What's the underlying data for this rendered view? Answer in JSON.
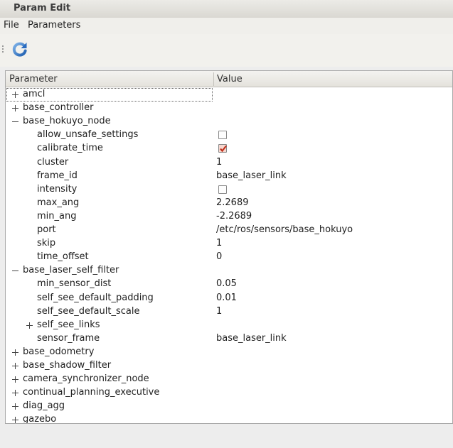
{
  "window": {
    "title": "Param Edit"
  },
  "menu": {
    "file": "File",
    "parameters": "Parameters"
  },
  "toolbar": {
    "refresh_icon": "refresh-icon"
  },
  "table": {
    "col_parameter": "Parameter",
    "col_value": "Value",
    "rows": [
      {
        "name": "amcl",
        "expander": "collapsed",
        "value": ""
      },
      {
        "name": "base_controller",
        "expander": "collapsed",
        "value": ""
      },
      {
        "name": "base_hokuyo_node",
        "expander": "expanded",
        "value": ""
      },
      {
        "name": "allow_unsafe_settings",
        "expander": "none",
        "value": "",
        "checkbox": false
      },
      {
        "name": "calibrate_time",
        "expander": "none",
        "value": "",
        "checkbox": true
      },
      {
        "name": "cluster",
        "expander": "none",
        "value": "1"
      },
      {
        "name": "frame_id",
        "expander": "none",
        "value": "base_laser_link"
      },
      {
        "name": "intensity",
        "expander": "none",
        "value": "",
        "checkbox": false
      },
      {
        "name": "max_ang",
        "expander": "none",
        "value": "2.2689"
      },
      {
        "name": "min_ang",
        "expander": "none",
        "value": "-2.2689"
      },
      {
        "name": "port",
        "expander": "none",
        "value": "/etc/ros/sensors/base_hokuyo"
      },
      {
        "name": "skip",
        "expander": "none",
        "value": "1"
      },
      {
        "name": "time_offset",
        "expander": "none",
        "value": "0"
      },
      {
        "name": "base_laser_self_filter",
        "expander": "expanded",
        "value": ""
      },
      {
        "name": "min_sensor_dist",
        "expander": "none",
        "value": "0.05"
      },
      {
        "name": "self_see_default_padding",
        "expander": "none",
        "value": "0.01"
      },
      {
        "name": "self_see_default_scale",
        "expander": "none",
        "value": "1"
      },
      {
        "name": "self_see_links",
        "expander": "collapsed",
        "value": ""
      },
      {
        "name": "sensor_frame",
        "expander": "none",
        "value": "base_laser_link"
      },
      {
        "name": "base_odometry",
        "expander": "collapsed",
        "value": ""
      },
      {
        "name": "base_shadow_filter",
        "expander": "collapsed",
        "value": ""
      },
      {
        "name": "camera_synchronizer_node",
        "expander": "collapsed",
        "value": ""
      },
      {
        "name": "continual_planning_executive",
        "expander": "collapsed",
        "value": ""
      },
      {
        "name": "diag_agg",
        "expander": "collapsed",
        "value": ""
      },
      {
        "name": "gazebo",
        "expander": "collapsed",
        "value": ""
      }
    ]
  }
}
